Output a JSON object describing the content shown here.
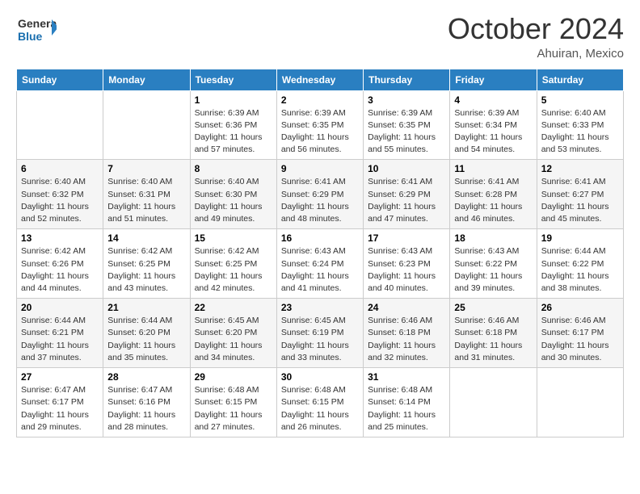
{
  "logo": {
    "line1": "General",
    "line2": "Blue",
    "icon": "▶"
  },
  "title": "October 2024",
  "location": "Ahuiran, Mexico",
  "days_of_week": [
    "Sunday",
    "Monday",
    "Tuesday",
    "Wednesday",
    "Thursday",
    "Friday",
    "Saturday"
  ],
  "weeks": [
    [
      {
        "day": "",
        "sunrise": "",
        "sunset": "",
        "daylight": ""
      },
      {
        "day": "",
        "sunrise": "",
        "sunset": "",
        "daylight": ""
      },
      {
        "day": "1",
        "sunrise": "Sunrise: 6:39 AM",
        "sunset": "Sunset: 6:36 PM",
        "daylight": "Daylight: 11 hours and 57 minutes."
      },
      {
        "day": "2",
        "sunrise": "Sunrise: 6:39 AM",
        "sunset": "Sunset: 6:35 PM",
        "daylight": "Daylight: 11 hours and 56 minutes."
      },
      {
        "day": "3",
        "sunrise": "Sunrise: 6:39 AM",
        "sunset": "Sunset: 6:35 PM",
        "daylight": "Daylight: 11 hours and 55 minutes."
      },
      {
        "day": "4",
        "sunrise": "Sunrise: 6:39 AM",
        "sunset": "Sunset: 6:34 PM",
        "daylight": "Daylight: 11 hours and 54 minutes."
      },
      {
        "day": "5",
        "sunrise": "Sunrise: 6:40 AM",
        "sunset": "Sunset: 6:33 PM",
        "daylight": "Daylight: 11 hours and 53 minutes."
      }
    ],
    [
      {
        "day": "6",
        "sunrise": "Sunrise: 6:40 AM",
        "sunset": "Sunset: 6:32 PM",
        "daylight": "Daylight: 11 hours and 52 minutes."
      },
      {
        "day": "7",
        "sunrise": "Sunrise: 6:40 AM",
        "sunset": "Sunset: 6:31 PM",
        "daylight": "Daylight: 11 hours and 51 minutes."
      },
      {
        "day": "8",
        "sunrise": "Sunrise: 6:40 AM",
        "sunset": "Sunset: 6:30 PM",
        "daylight": "Daylight: 11 hours and 49 minutes."
      },
      {
        "day": "9",
        "sunrise": "Sunrise: 6:41 AM",
        "sunset": "Sunset: 6:29 PM",
        "daylight": "Daylight: 11 hours and 48 minutes."
      },
      {
        "day": "10",
        "sunrise": "Sunrise: 6:41 AM",
        "sunset": "Sunset: 6:29 PM",
        "daylight": "Daylight: 11 hours and 47 minutes."
      },
      {
        "day": "11",
        "sunrise": "Sunrise: 6:41 AM",
        "sunset": "Sunset: 6:28 PM",
        "daylight": "Daylight: 11 hours and 46 minutes."
      },
      {
        "day": "12",
        "sunrise": "Sunrise: 6:41 AM",
        "sunset": "Sunset: 6:27 PM",
        "daylight": "Daylight: 11 hours and 45 minutes."
      }
    ],
    [
      {
        "day": "13",
        "sunrise": "Sunrise: 6:42 AM",
        "sunset": "Sunset: 6:26 PM",
        "daylight": "Daylight: 11 hours and 44 minutes."
      },
      {
        "day": "14",
        "sunrise": "Sunrise: 6:42 AM",
        "sunset": "Sunset: 6:25 PM",
        "daylight": "Daylight: 11 hours and 43 minutes."
      },
      {
        "day": "15",
        "sunrise": "Sunrise: 6:42 AM",
        "sunset": "Sunset: 6:25 PM",
        "daylight": "Daylight: 11 hours and 42 minutes."
      },
      {
        "day": "16",
        "sunrise": "Sunrise: 6:43 AM",
        "sunset": "Sunset: 6:24 PM",
        "daylight": "Daylight: 11 hours and 41 minutes."
      },
      {
        "day": "17",
        "sunrise": "Sunrise: 6:43 AM",
        "sunset": "Sunset: 6:23 PM",
        "daylight": "Daylight: 11 hours and 40 minutes."
      },
      {
        "day": "18",
        "sunrise": "Sunrise: 6:43 AM",
        "sunset": "Sunset: 6:22 PM",
        "daylight": "Daylight: 11 hours and 39 minutes."
      },
      {
        "day": "19",
        "sunrise": "Sunrise: 6:44 AM",
        "sunset": "Sunset: 6:22 PM",
        "daylight": "Daylight: 11 hours and 38 minutes."
      }
    ],
    [
      {
        "day": "20",
        "sunrise": "Sunrise: 6:44 AM",
        "sunset": "Sunset: 6:21 PM",
        "daylight": "Daylight: 11 hours and 37 minutes."
      },
      {
        "day": "21",
        "sunrise": "Sunrise: 6:44 AM",
        "sunset": "Sunset: 6:20 PM",
        "daylight": "Daylight: 11 hours and 35 minutes."
      },
      {
        "day": "22",
        "sunrise": "Sunrise: 6:45 AM",
        "sunset": "Sunset: 6:20 PM",
        "daylight": "Daylight: 11 hours and 34 minutes."
      },
      {
        "day": "23",
        "sunrise": "Sunrise: 6:45 AM",
        "sunset": "Sunset: 6:19 PM",
        "daylight": "Daylight: 11 hours and 33 minutes."
      },
      {
        "day": "24",
        "sunrise": "Sunrise: 6:46 AM",
        "sunset": "Sunset: 6:18 PM",
        "daylight": "Daylight: 11 hours and 32 minutes."
      },
      {
        "day": "25",
        "sunrise": "Sunrise: 6:46 AM",
        "sunset": "Sunset: 6:18 PM",
        "daylight": "Daylight: 11 hours and 31 minutes."
      },
      {
        "day": "26",
        "sunrise": "Sunrise: 6:46 AM",
        "sunset": "Sunset: 6:17 PM",
        "daylight": "Daylight: 11 hours and 30 minutes."
      }
    ],
    [
      {
        "day": "27",
        "sunrise": "Sunrise: 6:47 AM",
        "sunset": "Sunset: 6:17 PM",
        "daylight": "Daylight: 11 hours and 29 minutes."
      },
      {
        "day": "28",
        "sunrise": "Sunrise: 6:47 AM",
        "sunset": "Sunset: 6:16 PM",
        "daylight": "Daylight: 11 hours and 28 minutes."
      },
      {
        "day": "29",
        "sunrise": "Sunrise: 6:48 AM",
        "sunset": "Sunset: 6:15 PM",
        "daylight": "Daylight: 11 hours and 27 minutes."
      },
      {
        "day": "30",
        "sunrise": "Sunrise: 6:48 AM",
        "sunset": "Sunset: 6:15 PM",
        "daylight": "Daylight: 11 hours and 26 minutes."
      },
      {
        "day": "31",
        "sunrise": "Sunrise: 6:48 AM",
        "sunset": "Sunset: 6:14 PM",
        "daylight": "Daylight: 11 hours and 25 minutes."
      },
      {
        "day": "",
        "sunrise": "",
        "sunset": "",
        "daylight": ""
      },
      {
        "day": "",
        "sunrise": "",
        "sunset": "",
        "daylight": ""
      }
    ]
  ]
}
